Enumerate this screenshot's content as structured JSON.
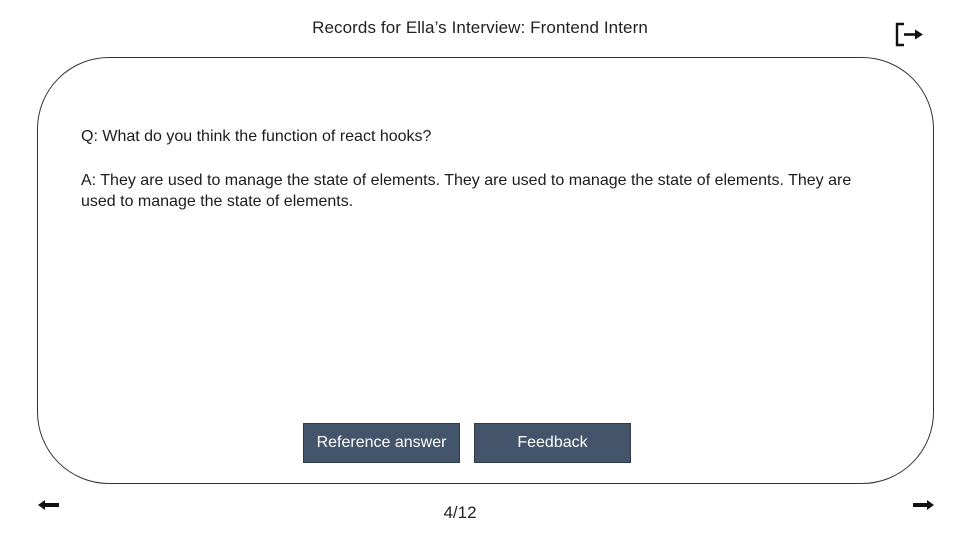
{
  "header": {
    "title": "Records for Ella’s Interview: Frontend Intern",
    "exit_icon": "logout-icon"
  },
  "record": {
    "question": "Q: What do you think the function of react hooks?",
    "answer": "A: They are used to manage the state of elements. They are used to manage the state of elements. They are used to manage the state of elements."
  },
  "actions": {
    "reference_label": "Reference answer",
    "feedback_label": "Feedback"
  },
  "pagination": {
    "current": 4,
    "total": 12,
    "label": "4/12",
    "prev_icon": "arrow-left-icon",
    "next_icon": "arrow-right-icon"
  },
  "colors": {
    "button_fill": "#44546a",
    "button_text": "#ffffff",
    "card_border": "#333333"
  }
}
